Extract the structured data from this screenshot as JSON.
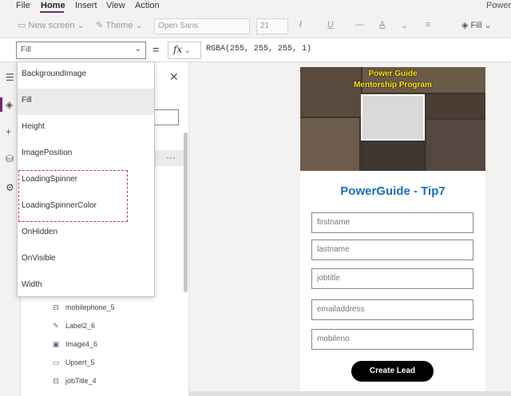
{
  "menu": {
    "file": "File",
    "home": "Home",
    "insert": "Insert",
    "view": "View",
    "action": "Action",
    "app_name": "PowerG"
  },
  "ribbon": {
    "new_screen": "New screen",
    "theme": "Theme",
    "font": "Open Sans",
    "font_size": "21",
    "fill_label": "Fill"
  },
  "formula_bar": {
    "property": "Fill",
    "fx": "fx",
    "formula": "RGBA(255, 255, 255, 1)"
  },
  "property_list": [
    {
      "label": "BackgroundImage"
    },
    {
      "label": "Fill"
    },
    {
      "label": "Height"
    },
    {
      "label": "ImagePosition"
    },
    {
      "label": "LoadingSpinner"
    },
    {
      "label": "LoadingSpinnerColor"
    },
    {
      "label": "OnHidden"
    },
    {
      "label": "OnVisible"
    },
    {
      "label": "Width"
    }
  ],
  "tree_items": [
    {
      "label": "mobilephone_5",
      "icon": "text-input-icon"
    },
    {
      "label": "Label2_6",
      "icon": "label-icon"
    },
    {
      "label": "Image4_6",
      "icon": "image-icon"
    },
    {
      "label": "Upsert_5",
      "icon": "button-icon"
    },
    {
      "label": "jobTitle_4",
      "icon": "text-input-icon"
    }
  ],
  "app": {
    "banner_title_line1": "Power Guide",
    "banner_title_line2": "Mentorship Program",
    "title": "PowerGuide - Tip7",
    "fields": [
      {
        "placeholder": "firstname"
      },
      {
        "placeholder": "lastname"
      },
      {
        "placeholder": "jobtitle"
      },
      {
        "placeholder": "emailaddress"
      },
      {
        "placeholder": "mobileno"
      }
    ],
    "button": "Create Lead"
  },
  "colors": {
    "accent": "#742774",
    "title_blue": "#1a6fc0",
    "banner_text": "#ffe600",
    "highlight_border": "#d42c4a"
  }
}
